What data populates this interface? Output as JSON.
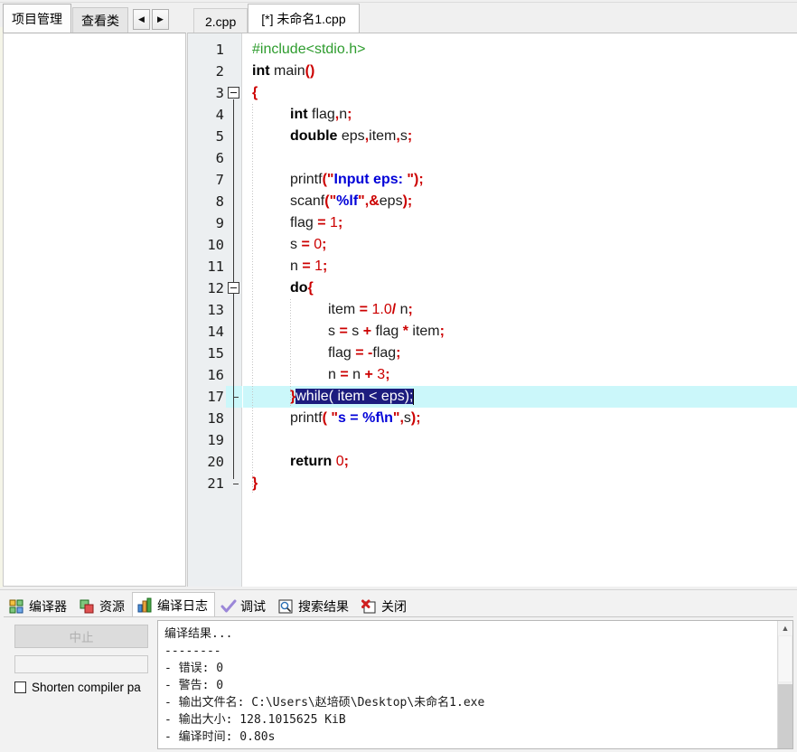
{
  "window": {
    "left_pane_tabs": [
      {
        "label": "项目管理",
        "active": true
      },
      {
        "label": "查看类",
        "active": false
      }
    ],
    "nav_prev": "◀",
    "nav_next": "▶",
    "editor_tabs": [
      {
        "label": "2.cpp",
        "active": false
      },
      {
        "label": "[*] 未命名1.cpp",
        "active": true
      }
    ]
  },
  "editor": {
    "lines": [
      {
        "n": "1",
        "indent": 0,
        "tokens": [
          {
            "t": "#include<stdio.h>",
            "c": "pp"
          }
        ]
      },
      {
        "n": "2",
        "indent": 0,
        "tokens": [
          {
            "t": "int",
            "c": "k"
          },
          {
            "t": " main",
            "c": "id"
          },
          {
            "t": "()",
            "c": "op"
          }
        ]
      },
      {
        "n": "3",
        "indent": 0,
        "tokens": [
          {
            "t": "{",
            "c": "brc"
          }
        ],
        "fold": "start"
      },
      {
        "n": "4",
        "indent": 1,
        "tokens": [
          {
            "t": "int",
            "c": "k"
          },
          {
            "t": " flag",
            "c": "id"
          },
          {
            "t": ",",
            "c": "op"
          },
          {
            "t": "n",
            "c": "id"
          },
          {
            "t": ";",
            "c": "op"
          }
        ]
      },
      {
        "n": "5",
        "indent": 1,
        "tokens": [
          {
            "t": "double",
            "c": "k"
          },
          {
            "t": " eps",
            "c": "id"
          },
          {
            "t": ",",
            "c": "op"
          },
          {
            "t": "item",
            "c": "id"
          },
          {
            "t": ",",
            "c": "op"
          },
          {
            "t": "s",
            "c": "id"
          },
          {
            "t": ";",
            "c": "op"
          }
        ]
      },
      {
        "n": "6",
        "indent": 1,
        "tokens": []
      },
      {
        "n": "7",
        "indent": 1,
        "tokens": [
          {
            "t": "printf",
            "c": "id"
          },
          {
            "t": "(",
            "c": "op"
          },
          {
            "t": "\"",
            "c": "qt"
          },
          {
            "t": "Input eps: ",
            "c": "st"
          },
          {
            "t": "\"",
            "c": "qt"
          },
          {
            "t": ")",
            "c": "op"
          },
          {
            "t": ";",
            "c": "op"
          }
        ]
      },
      {
        "n": "8",
        "indent": 1,
        "tokens": [
          {
            "t": "scanf",
            "c": "id"
          },
          {
            "t": "(",
            "c": "op"
          },
          {
            "t": "\"",
            "c": "qt"
          },
          {
            "t": "%lf",
            "c": "st"
          },
          {
            "t": "\"",
            "c": "qt"
          },
          {
            "t": ",",
            "c": "op"
          },
          {
            "t": "&",
            "c": "op"
          },
          {
            "t": "eps",
            "c": "id"
          },
          {
            "t": ")",
            "c": "op"
          },
          {
            "t": ";",
            "c": "op"
          }
        ]
      },
      {
        "n": "9",
        "indent": 1,
        "tokens": [
          {
            "t": "flag ",
            "c": "id"
          },
          {
            "t": "=",
            "c": "op"
          },
          {
            "t": " ",
            "c": "id"
          },
          {
            "t": "1",
            "c": "num"
          },
          {
            "t": ";",
            "c": "op"
          }
        ]
      },
      {
        "n": "10",
        "indent": 1,
        "tokens": [
          {
            "t": "s ",
            "c": "id"
          },
          {
            "t": "=",
            "c": "op"
          },
          {
            "t": " ",
            "c": "id"
          },
          {
            "t": "0",
            "c": "num"
          },
          {
            "t": ";",
            "c": "op"
          }
        ]
      },
      {
        "n": "11",
        "indent": 1,
        "tokens": [
          {
            "t": "n ",
            "c": "id"
          },
          {
            "t": "=",
            "c": "op"
          },
          {
            "t": " ",
            "c": "id"
          },
          {
            "t": "1",
            "c": "num"
          },
          {
            "t": ";",
            "c": "op"
          }
        ]
      },
      {
        "n": "12",
        "indent": 1,
        "tokens": [
          {
            "t": "do",
            "c": "k"
          },
          {
            "t": "{",
            "c": "brc"
          }
        ],
        "fold": "start2"
      },
      {
        "n": "13",
        "indent": 2,
        "tokens": [
          {
            "t": "item ",
            "c": "id"
          },
          {
            "t": "=",
            "c": "op"
          },
          {
            "t": " ",
            "c": "id"
          },
          {
            "t": "1.0",
            "c": "num"
          },
          {
            "t": "/",
            "c": "op"
          },
          {
            "t": " n",
            "c": "id"
          },
          {
            "t": ";",
            "c": "op"
          }
        ]
      },
      {
        "n": "14",
        "indent": 2,
        "tokens": [
          {
            "t": "s ",
            "c": "id"
          },
          {
            "t": "=",
            "c": "op"
          },
          {
            "t": " s ",
            "c": "id"
          },
          {
            "t": "+",
            "c": "op"
          },
          {
            "t": " flag ",
            "c": "id"
          },
          {
            "t": "*",
            "c": "op"
          },
          {
            "t": " item",
            "c": "id"
          },
          {
            "t": ";",
            "c": "op"
          }
        ]
      },
      {
        "n": "15",
        "indent": 2,
        "tokens": [
          {
            "t": "flag ",
            "c": "id"
          },
          {
            "t": "=",
            "c": "op"
          },
          {
            "t": " ",
            "c": "id"
          },
          {
            "t": "-",
            "c": "op"
          },
          {
            "t": "flag",
            "c": "id"
          },
          {
            "t": ";",
            "c": "op"
          }
        ]
      },
      {
        "n": "16",
        "indent": 2,
        "tokens": [
          {
            "t": "n ",
            "c": "id"
          },
          {
            "t": "=",
            "c": "op"
          },
          {
            "t": " n ",
            "c": "id"
          },
          {
            "t": "+",
            "c": "op"
          },
          {
            "t": " ",
            "c": "id"
          },
          {
            "t": "3",
            "c": "num"
          },
          {
            "t": ";",
            "c": "op"
          }
        ]
      },
      {
        "n": "17",
        "indent": 1,
        "current": true,
        "selection": "while( item < eps);",
        "tokens": [
          {
            "t": "}",
            "c": "brc"
          }
        ]
      },
      {
        "n": "18",
        "indent": 1,
        "tokens": [
          {
            "t": "printf",
            "c": "id"
          },
          {
            "t": "(",
            "c": "op"
          },
          {
            "t": " ",
            "c": "id"
          },
          {
            "t": "\"",
            "c": "qt"
          },
          {
            "t": "s = %f\\n",
            "c": "st"
          },
          {
            "t": "\"",
            "c": "qt"
          },
          {
            "t": ",",
            "c": "op"
          },
          {
            "t": "s",
            "c": "id"
          },
          {
            "t": ")",
            "c": "op"
          },
          {
            "t": ";",
            "c": "op"
          }
        ]
      },
      {
        "n": "19",
        "indent": 1,
        "tokens": []
      },
      {
        "n": "20",
        "indent": 1,
        "tokens": [
          {
            "t": "return",
            "c": "k"
          },
          {
            "t": " ",
            "c": "id"
          },
          {
            "t": "0",
            "c": "num"
          },
          {
            "t": ";",
            "c": "op"
          }
        ]
      },
      {
        "n": "21",
        "indent": 0,
        "tokens": [
          {
            "t": "}",
            "c": "brc"
          }
        ],
        "fold": "end"
      }
    ],
    "current_line_color": "#cbf7fa",
    "selection_color": "#1c1c7e"
  },
  "bottom_panel": {
    "tabs": [
      {
        "label": "编译器",
        "icon": "compiler-icon",
        "active": false
      },
      {
        "label": "资源",
        "icon": "resources-icon",
        "active": false
      },
      {
        "label": "编译日志",
        "icon": "compile-log-icon",
        "active": true
      },
      {
        "label": "调试",
        "icon": "debug-check-icon",
        "active": false
      },
      {
        "label": "搜索结果",
        "icon": "search-results-icon",
        "active": false
      },
      {
        "label": "关闭",
        "icon": "close-red-icon",
        "active": false
      }
    ],
    "abort_button": "中止",
    "shorten_checkbox_label": "Shorten compiler pa",
    "shorten_checked": false,
    "log_lines": [
      "编译结果...",
      "--------",
      "- 错误: 0",
      "- 警告: 0",
      "- 输出文件名: C:\\Users\\赵培硕\\Desktop\\未命名1.exe",
      "- 输出大小: 128.1015625 KiB",
      "- 编译时间: 0.80s"
    ],
    "scroll_up_glyph": "▲"
  }
}
